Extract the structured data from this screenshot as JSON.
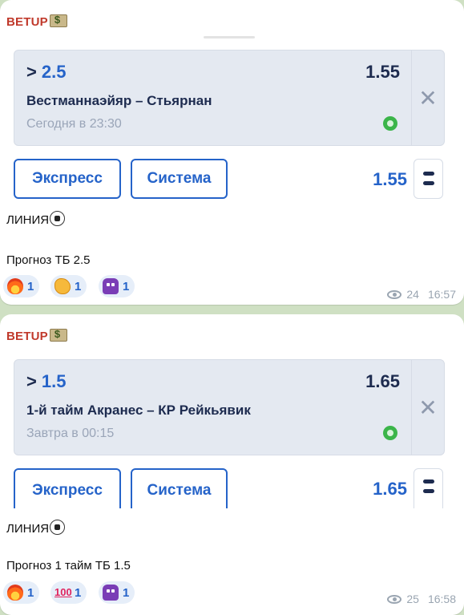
{
  "messages": [
    {
      "sender": "BETUP",
      "bet": {
        "selection_prefix": ">",
        "selection_value": "2.5",
        "coefficient": "1.55",
        "event": "Вестманнаэйяр – Стьярнан",
        "time": "Сегодня в 23:30"
      },
      "buttons": {
        "express": "Экспресс",
        "system": "Система"
      },
      "total_coefficient": "1.55",
      "line_label": "ЛИНИЯ",
      "forecast": "Прогноз ТБ 2.5",
      "reactions": [
        {
          "icon": "fire-icon",
          "count": "1"
        },
        {
          "icon": "clap-icon",
          "count": "1"
        },
        {
          "icon": "space-invader-icon",
          "count": "1"
        }
      ],
      "views": "24",
      "timestamp": "16:57"
    },
    {
      "sender": "BETUP",
      "bet": {
        "selection_prefix": ">",
        "selection_value": "1.5",
        "coefficient": "1.65",
        "event": "1-й тайм Акранес – КР Рейкьявик",
        "time": "Завтра в 00:15"
      },
      "buttons": {
        "express": "Экспресс",
        "system": "Система"
      },
      "total_coefficient": "1.65",
      "line_label": "ЛИНИЯ",
      "forecast": "Прогноз 1 тайм ТБ 1.5",
      "reactions": [
        {
          "icon": "fire-icon",
          "count": "1"
        },
        {
          "icon": "hundred-points-icon",
          "count": "1"
        },
        {
          "icon": "space-invader-icon",
          "count": "1"
        }
      ],
      "views": "25",
      "timestamp": "16:58"
    }
  ],
  "colors": {
    "sender": "#c0392b",
    "accent": "#2563c9",
    "card_bg": "#e4e9f1",
    "chat_bg": "#cfe0c3"
  }
}
